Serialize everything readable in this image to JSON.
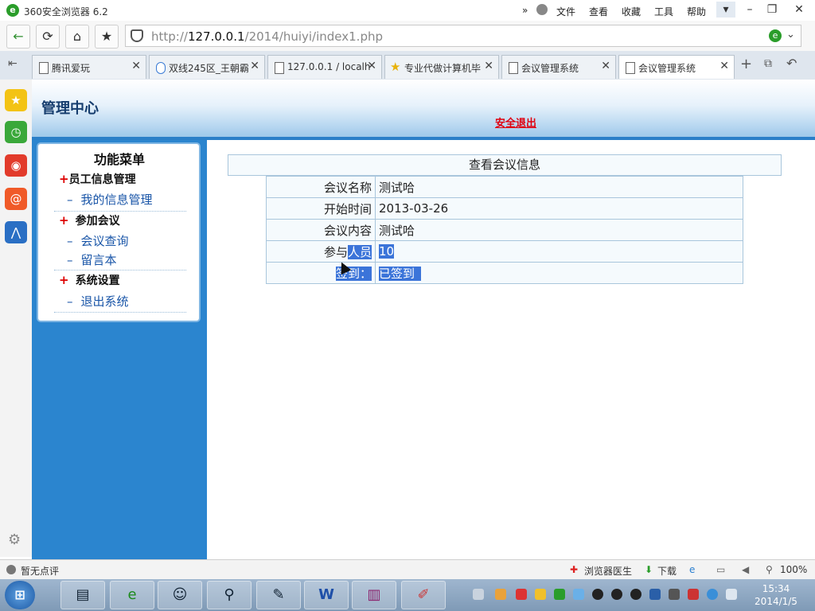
{
  "window": {
    "title": "360安全浏览器 6.2",
    "menus": [
      "文件",
      "查看",
      "收藏",
      "工具",
      "帮助"
    ],
    "more_label": "»"
  },
  "address": {
    "url_host": "127.0.0.1",
    "url_prefix": "http://",
    "url_path": "/2014/huiyi/index1.php"
  },
  "tabs": [
    {
      "label": "腾讯爱玩"
    },
    {
      "label": "双线245区_王朝霸"
    },
    {
      "label": "127.0.0.1 / localh"
    },
    {
      "label": "专业代做计算机毕"
    },
    {
      "label": "会议管理系统"
    },
    {
      "label": "会议管理系统"
    }
  ],
  "header": {
    "title": "管理中心",
    "logout": "安全退出"
  },
  "menu": {
    "title": "功能菜单",
    "sections": [
      {
        "title": "员工信息管理",
        "items": [
          "我的信息管理"
        ]
      },
      {
        "title": "参加会议",
        "items": [
          "会议查询",
          "留言本"
        ]
      },
      {
        "title": "系统设置",
        "items": [
          "退出系统"
        ]
      }
    ]
  },
  "info": {
    "title": "查看会议信息",
    "rows": [
      {
        "label": "会议名称",
        "value": "测试哈"
      },
      {
        "label": "开始时间",
        "value": "2013-03-26"
      },
      {
        "label": "会议内容",
        "value": "测试哈"
      },
      {
        "label_plain": "参与",
        "label_selected": "人员",
        "value": "10"
      },
      {
        "label": "签到：",
        "value": "已签到"
      }
    ]
  },
  "statusbar": {
    "comment": "暂无点评",
    "doctor": "浏览器医生",
    "download": "下载",
    "zoom": "100%"
  },
  "taskbar": {
    "time": "15:34",
    "date": "2014/1/5"
  },
  "colors": {
    "accent": "#2b85cf",
    "logout": "#e0000f",
    "selection": "#3b74d9"
  }
}
